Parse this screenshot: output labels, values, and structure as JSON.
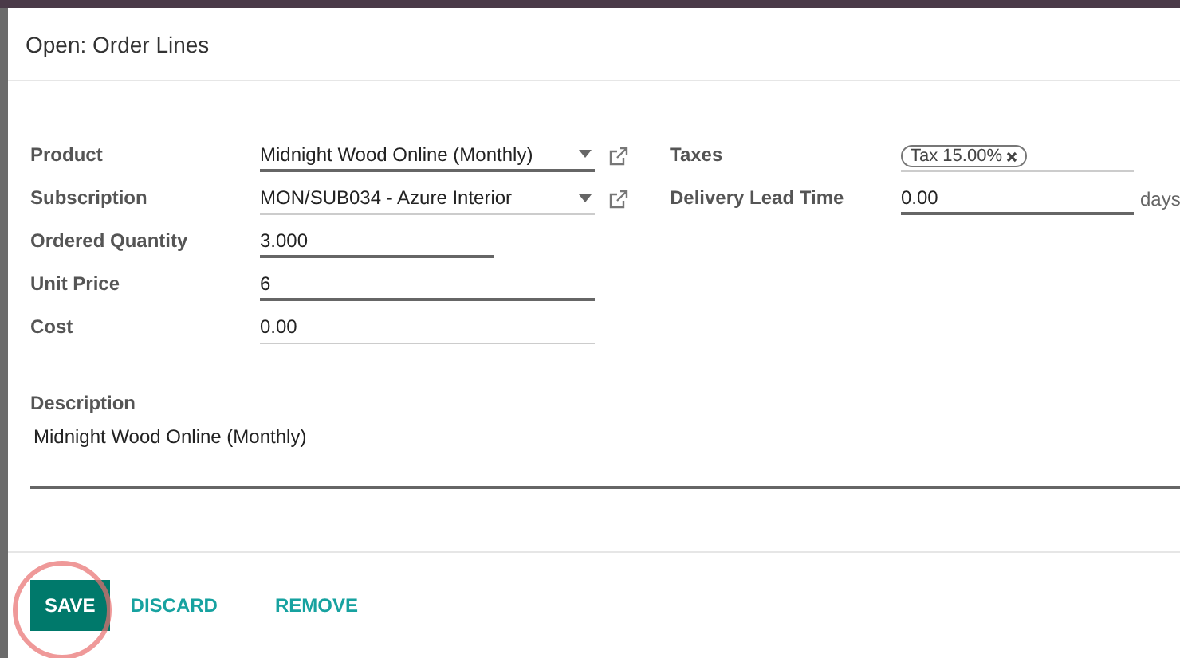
{
  "dialog": {
    "title": "Open: Order Lines"
  },
  "left_fields": [
    {
      "label": "Product",
      "kind": "select",
      "value": "Midnight Wood Online (Monthly)",
      "required": true
    },
    {
      "label": "Subscription",
      "kind": "select",
      "value": "MON/SUB034 - Azure Interior",
      "required": false
    },
    {
      "label": "Ordered Quantity",
      "kind": "input",
      "value": "3.000",
      "required": true,
      "short": true
    },
    {
      "label": "Unit Price",
      "kind": "input",
      "value": "6",
      "required": true
    },
    {
      "label": "Cost",
      "kind": "input",
      "value": "0.00",
      "required": false
    }
  ],
  "right_fields": [
    {
      "label": "Taxes",
      "kind": "tags",
      "tags": [
        "Tax 15.00%"
      ],
      "required": false
    },
    {
      "label": "Delivery Lead Time",
      "kind": "input",
      "value": "0.00",
      "unit": "days",
      "required": true
    }
  ],
  "description": {
    "label": "Description",
    "value": "Midnight Wood Online (Monthly)"
  },
  "buttons": [
    {
      "label": "SAVE",
      "primary": true
    },
    {
      "label": "DISCARD",
      "primary": false
    },
    {
      "label": "REMOVE",
      "primary": false
    }
  ]
}
